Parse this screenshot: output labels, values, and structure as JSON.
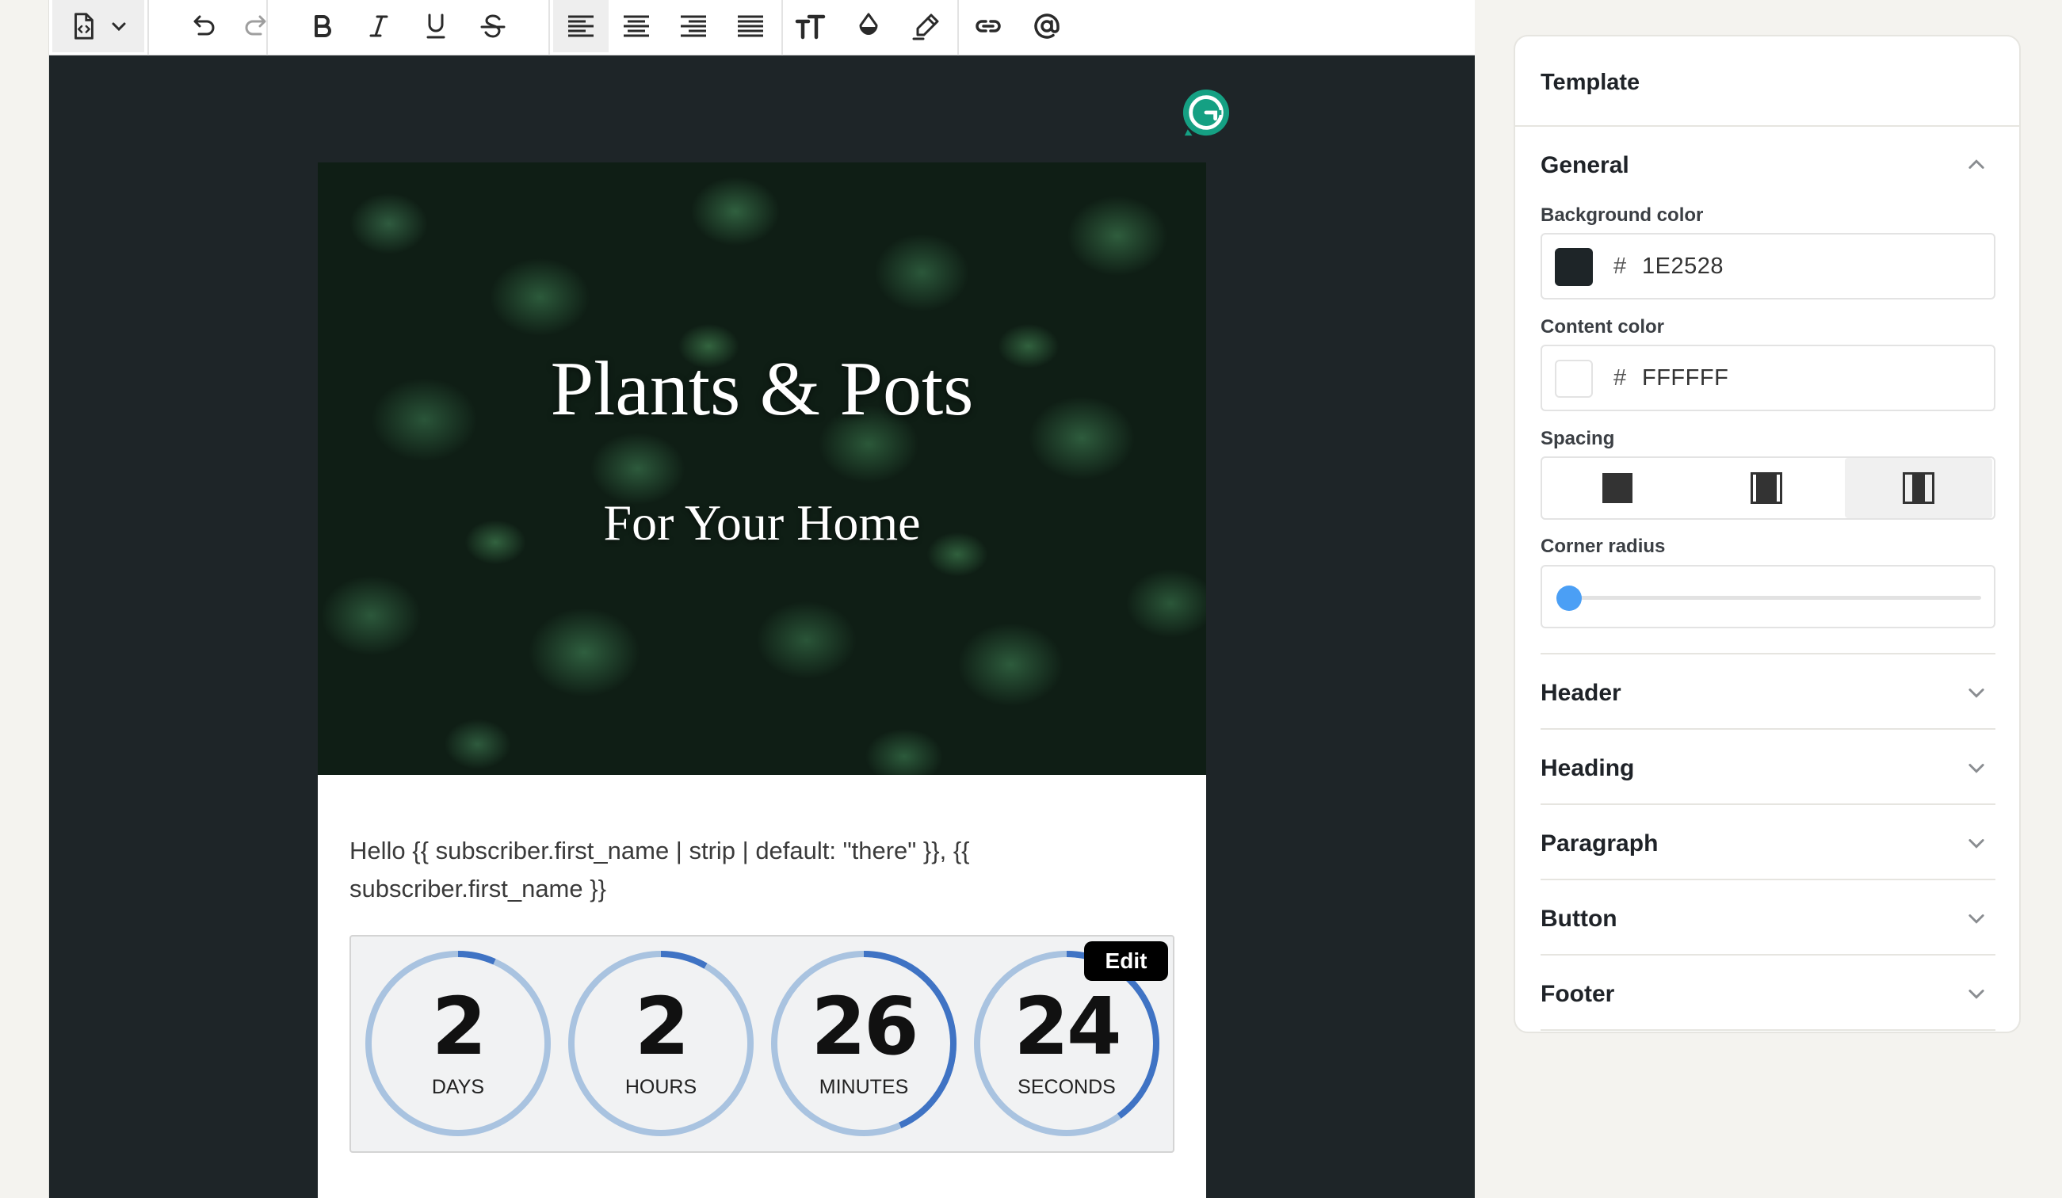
{
  "email": {
    "title": "Plants & Pots",
    "subtitle": "For Your Home",
    "greeting": "Hello {{ subscriber.first_name | strip | default: \"there\" }}, {{ subscriber.first_name }}",
    "countdown": [
      {
        "value": "2",
        "label": "DAYS",
        "progress": 0.0667
      },
      {
        "value": "2",
        "label": "HOURS",
        "progress": 0.0833
      },
      {
        "value": "26",
        "label": "MINUTES",
        "progress": 0.4333
      },
      {
        "value": "24",
        "label": "SECONDS",
        "progress": 0.4
      }
    ],
    "edit_label": "Edit"
  },
  "toolbar": {
    "buttons": [
      "code-file-icon",
      "chevron-down-icon",
      "undo-icon",
      "redo-icon",
      "bold-icon",
      "italic-icon",
      "underline-icon",
      "strikethrough-icon",
      "align-left-icon",
      "align-center-icon",
      "align-right-icon",
      "align-justify-icon",
      "text-size-icon",
      "text-color-icon",
      "highlight-icon",
      "link-icon",
      "mention-icon"
    ],
    "active": "align-left-icon"
  },
  "panel": {
    "title": "Template",
    "general": {
      "heading": "General",
      "background_label": "Background color",
      "background_value": "1E2528",
      "content_label": "Content color",
      "content_value": "FFFFFF",
      "spacing_label": "Spacing",
      "spacing_selected": 2,
      "radius_label": "Corner radius",
      "radius_value": 0.03
    },
    "sections": [
      "Header",
      "Heading",
      "Paragraph",
      "Button",
      "Footer"
    ]
  },
  "colors": {
    "canvas_bg": "#1E2528",
    "content_bg": "#FFFFFF",
    "accent": "#4B9FF5",
    "timer_ring": "#A9C3E0",
    "timer_progress": "#3F73C4",
    "grammarly": "#15A083"
  }
}
